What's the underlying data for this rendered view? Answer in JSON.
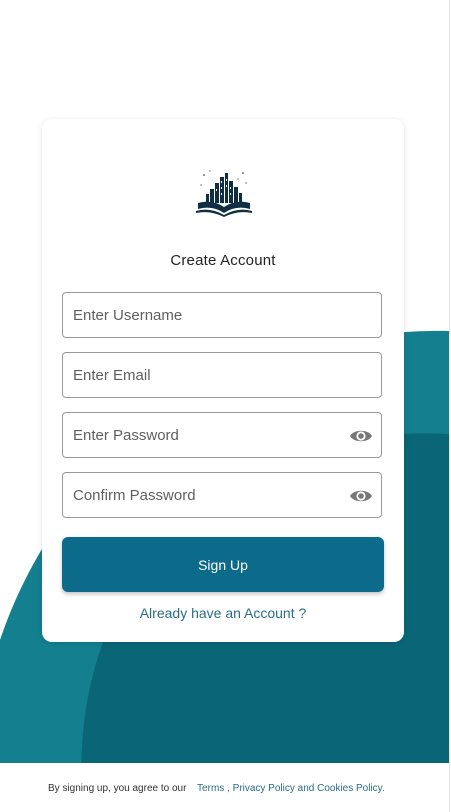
{
  "card": {
    "title": "Create Account"
  },
  "form": {
    "username_placeholder": "Enter Username",
    "email_placeholder": "Enter Email",
    "password_placeholder": "Enter Password",
    "confirm_placeholder": "Confirm Password",
    "submit_label": "Sign Up",
    "login_link": "Already have an Account ?"
  },
  "footer": {
    "prefix": "By signing up, you agree to our",
    "terms": "Terms",
    "separator": " , ",
    "policy": "Privacy Policy and Cookies Policy."
  },
  "icons": {
    "logo": "city-book-logo-icon",
    "password_toggle": "eye-icon"
  },
  "colors": {
    "primary": "#0c6b8a",
    "background_teal_dark": "#0a6676",
    "background_teal_light": "#137f8f",
    "link": "#2a6d88"
  }
}
